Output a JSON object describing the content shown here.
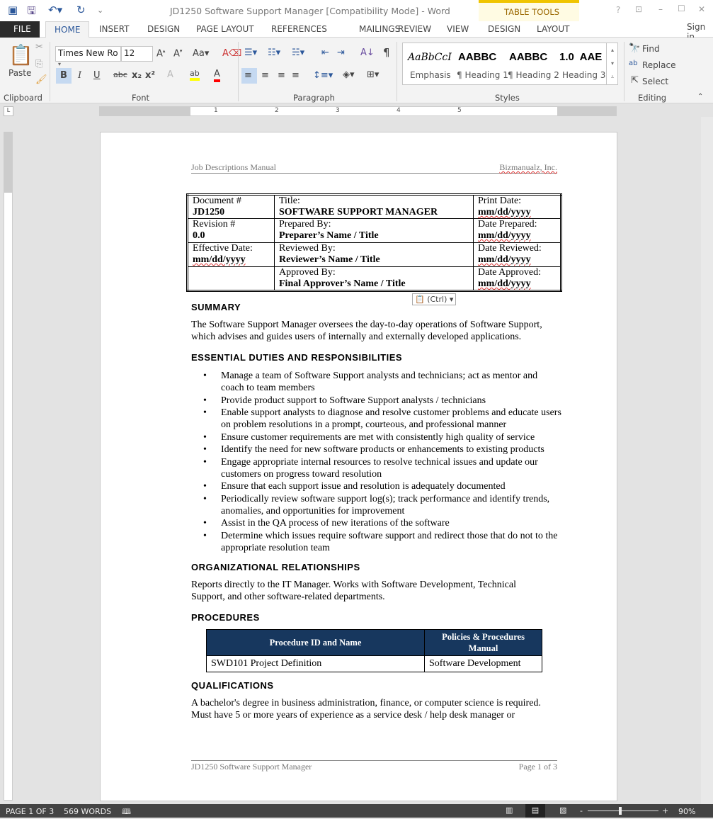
{
  "window": {
    "title": "JD1250 Software Support Manager [Compatibility Mode] - Word",
    "sign_in": "Sign in",
    "help": "?",
    "minimize": "–",
    "maximize": "☐",
    "close": "✕"
  },
  "tabs": [
    "FILE",
    "HOME",
    "INSERT",
    "DESIGN",
    "PAGE LAYOUT",
    "REFERENCES",
    "MAILINGS",
    "REVIEW",
    "VIEW"
  ],
  "table_tools": {
    "label": "TABLE TOOLS",
    "tabs": [
      "DESIGN",
      "LAYOUT"
    ]
  },
  "ribbon": {
    "clipboard": {
      "label": "Clipboard",
      "paste": "Paste"
    },
    "font": {
      "label": "Font",
      "name": "Times New Ro",
      "size": "12",
      "bold": "B",
      "italic": "I",
      "underline": "U",
      "strike": "abc",
      "sub": "x₂",
      "sup": "x²",
      "highlight": "#ffff00",
      "font_color": "#ff0000"
    },
    "paragraph": {
      "label": "Paragraph"
    },
    "styles": {
      "label": "Styles",
      "items": [
        {
          "preview": "AaBbCcI",
          "name": "Emphasis"
        },
        {
          "preview": "AABBC",
          "name": "¶ Heading 1"
        },
        {
          "preview": "AABBC",
          "name": "¶ Heading 2"
        },
        {
          "preview": "1.0  AAE",
          "name": "Heading 3"
        }
      ]
    },
    "editing": {
      "label": "Editing",
      "find": "Find",
      "replace": "Replace",
      "select": "Select"
    }
  },
  "ruler": {
    "marks": [
      "1",
      "2",
      "3",
      "4",
      "5"
    ]
  },
  "document": {
    "header_left": "Job Descriptions Manual",
    "header_right": "Bizmanualz, Inc.",
    "info_table": [
      [
        {
          "label": "Document #",
          "value": "JD1250"
        },
        {
          "label": "Title:",
          "value": "SOFTWARE SUPPORT MANAGER"
        },
        {
          "label": "Print Date:",
          "value": "mm/dd/yyyy"
        }
      ],
      [
        {
          "label": "Revision #",
          "value": "0.0"
        },
        {
          "label": "Prepared By:",
          "value": "Preparer’s Name / Title"
        },
        {
          "label": "Date Prepared:",
          "value": "mm/dd/yyyy"
        }
      ],
      [
        {
          "label": "Effective Date:",
          "value": "mm/dd/yyyy"
        },
        {
          "label": "Reviewed By:",
          "value": "Reviewer’s Name / Title"
        },
        {
          "label": "Date Reviewed:",
          "value": "mm/dd/yyyy"
        }
      ],
      [
        {
          "label": "",
          "value": ""
        },
        {
          "label": "Approved By:",
          "value": "Final Approver’s Name / Title"
        },
        {
          "label": "Date Approved:",
          "value": "mm/dd/yyyy"
        }
      ]
    ],
    "paste_options": "(Ctrl)",
    "summary_heading": "SUMMARY",
    "summary": "The Software Support Manager oversees the day-to-day operations of Software Support, which advises and guides users of internally and externally developed applications.",
    "duties_heading": "ESSENTIAL DUTIES AND RESPONSIBILITIES",
    "duties": [
      "Manage a team of Software Support analysts and technicians; act as mentor and coach to team members",
      "Provide product support to Software Support analysts / technicians",
      "Enable support analysts to diagnose and resolve customer problems and educate users on problem resolutions in a prompt, courteous, and professional manner",
      "Ensure customer requirements are met with consistently high quality of service",
      "Identify the need for new software products or enhancements to existing products",
      "Engage appropriate internal resources to resolve technical issues and update our customers on progress toward resolution",
      "Ensure that each support issue and resolution is adequately documented",
      "Periodically review software support log(s); track performance and identify trends, anomalies, and opportunities for improvement",
      "Assist in the QA process of new iterations of the software",
      "Determine which issues require software support and redirect those that do not to the appropriate resolution team"
    ],
    "org_heading": "ORGANIZATIONAL RELATIONSHIPS",
    "org": "Reports directly to the IT Manager. Works with Software Development, Technical Support, and other software-related departments.",
    "proc_heading": "PROCEDURES",
    "proc_table": {
      "headers": [
        "Procedure ID and Name",
        "Policies & Procedures Manual"
      ],
      "rows": [
        [
          "SWD101 Project Definition",
          "Software Development"
        ]
      ],
      "header_color": "#17375e"
    },
    "qual_heading": "QUALIFICATIONS",
    "qual": "A bachelor's degree in business administration, finance, or computer science is required. Must have 5 or more years of experience as a service desk / help desk manager or",
    "footer_left": "JD1250 Software Support Manager",
    "footer_right": "Page 1 of 3"
  },
  "status": {
    "page": "PAGE 1 OF 3",
    "words": "569 WORDS",
    "zoom": "90%",
    "zoom_minus": "-",
    "zoom_plus": "+"
  }
}
